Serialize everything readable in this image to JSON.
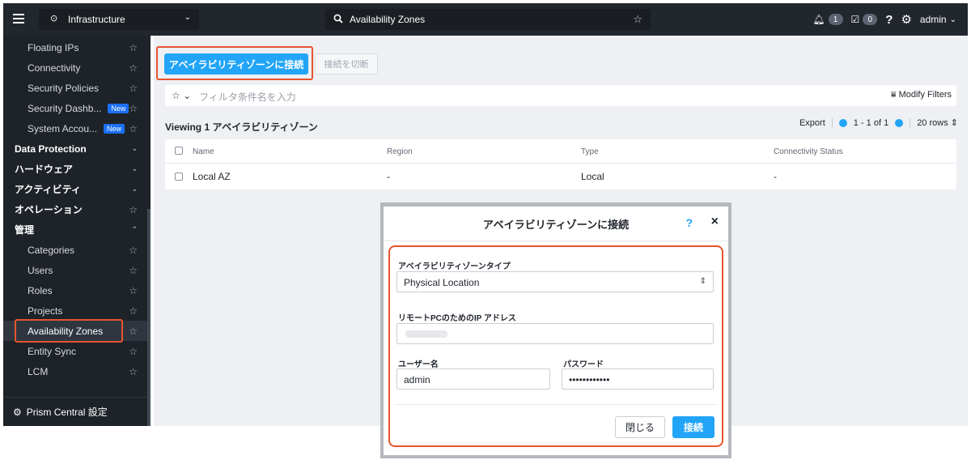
{
  "topbar": {
    "app_name": "Infrastructure",
    "search_text": "Availability Zones",
    "alerts_count": "1",
    "tasks_count": "0",
    "help": "?",
    "user": "admin"
  },
  "sidebar": {
    "items": [
      {
        "label": "Floating IPs",
        "type": "sub"
      },
      {
        "label": "Connectivity",
        "type": "sub"
      },
      {
        "label": "Security Policies",
        "type": "sub"
      },
      {
        "label": "Security Dashb...",
        "type": "sub",
        "badge": "New"
      },
      {
        "label": "System Accou...",
        "type": "sub",
        "badge": "New"
      },
      {
        "label": "Data Protection",
        "type": "section"
      },
      {
        "label": "ハードウェア",
        "type": "section"
      },
      {
        "label": "アクティビティ",
        "type": "section"
      },
      {
        "label": "オペレーション",
        "type": "section"
      },
      {
        "label": "管理",
        "type": "section"
      },
      {
        "label": "Categories",
        "type": "sub"
      },
      {
        "label": "Users",
        "type": "sub"
      },
      {
        "label": "Roles",
        "type": "sub"
      },
      {
        "label": "Projects",
        "type": "sub"
      },
      {
        "label": "Availability Zones",
        "type": "sub",
        "active": true
      },
      {
        "label": "Entity Sync",
        "type": "sub"
      },
      {
        "label": "LCM",
        "type": "sub"
      }
    ],
    "footer": "Prism Central 設定"
  },
  "main": {
    "connect_button": "アベイラビリティゾーンに接続",
    "disconnect_button": "接続を切断",
    "filter_placeholder": "フィルタ条件名を入力",
    "modify_filters": "Modify Filters",
    "viewing": "Viewing 1 アベイラビリティゾーン",
    "export": "Export",
    "pagination": "1 - 1 of 1",
    "rows": "20 rows",
    "columns": [
      "Name",
      "Region",
      "Type",
      "Connectivity Status"
    ],
    "rows_data": [
      [
        "Local AZ",
        "-",
        "Local",
        "-"
      ]
    ]
  },
  "modal": {
    "title": "アベイラビリティゾーンに接続",
    "help": "?",
    "close": "×",
    "type_label": "アベイラビリティゾーンタイプ",
    "type_value": "Physical Location",
    "ip_label": "リモートPCのためのIP アドレス",
    "user_label": "ユーザー名",
    "user_value": "admin",
    "password_label": "パスワード",
    "password_value": "••••••••••••",
    "cancel_button": "閉じる",
    "ok_button": "接続"
  },
  "colors": {
    "accent": "#22a5f7",
    "highlight": "#e8542f",
    "sidebar_bg": "#1e2329",
    "topbar_bg": "#22272e",
    "new_badge": "#1b6ff5"
  }
}
